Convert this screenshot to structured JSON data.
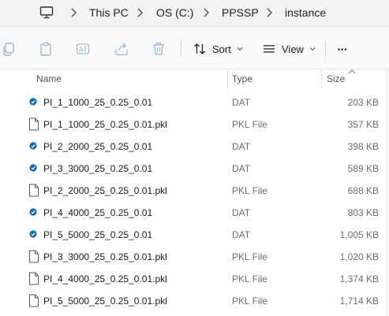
{
  "breadcrumb": {
    "items": [
      "This PC",
      "OS (C:)",
      "PPSSP",
      "instance"
    ]
  },
  "toolbar": {
    "sort_label": "Sort",
    "view_label": "View",
    "more_label": "•••"
  },
  "columns": {
    "name": "Name",
    "type": "Type",
    "size": "Size"
  },
  "files": [
    {
      "name": "PI_1_1000_25_0.25_0.01",
      "type": "DAT",
      "size": "203 KB",
      "icon": "dat-file-icon"
    },
    {
      "name": "PI_1_1000_25_0.25_0.01.pkl",
      "type": "PKL File",
      "size": "357 KB",
      "icon": "generic-file-icon"
    },
    {
      "name": "PI_2_2000_25_0.25_0.01",
      "type": "DAT",
      "size": "398 KB",
      "icon": "dat-file-icon"
    },
    {
      "name": "PI_3_3000_25_0.25_0.01",
      "type": "DAT",
      "size": "589 KB",
      "icon": "dat-file-icon"
    },
    {
      "name": "PI_2_2000_25_0.25_0.01.pkl",
      "type": "PKL File",
      "size": "688 KB",
      "icon": "generic-file-icon"
    },
    {
      "name": "PI_4_4000_25_0.25_0.01",
      "type": "DAT",
      "size": "803 KB",
      "icon": "dat-file-icon"
    },
    {
      "name": "PI_5_5000_25_0.25_0.01",
      "type": "DAT",
      "size": "1,005 KB",
      "icon": "dat-file-icon"
    },
    {
      "name": "PI_3_3000_25_0.25_0.01.pkl",
      "type": "PKL File",
      "size": "1,020 KB",
      "icon": "generic-file-icon"
    },
    {
      "name": "PI_4_4000_25_0.25_0.01.pkl",
      "type": "PKL File",
      "size": "1,374 KB",
      "icon": "generic-file-icon"
    },
    {
      "name": "PI_5_5000_25_0.25_0.01.pkl",
      "type": "PKL File",
      "size": "1,714 KB",
      "icon": "generic-file-icon"
    }
  ],
  "colors": {
    "accent": "#0f6cbd",
    "icon_disabled": "#9ab8d6"
  }
}
